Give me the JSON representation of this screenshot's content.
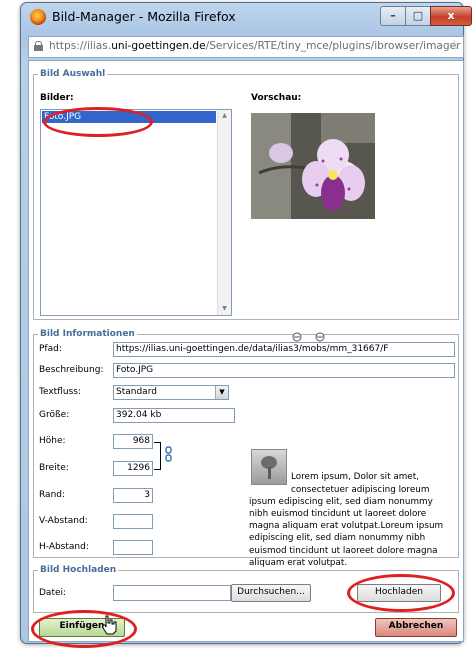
{
  "window": {
    "title": "Bild-Manager - Mozilla Firefox",
    "url_prefix": "https://ilias.",
    "url_domain": "uni-goettingen.de",
    "url_path": "/Services/RTE/tiny_mce/plugins/ibrowser/imager",
    "controls": {
      "minimize": "–",
      "maximize": "□",
      "close": "x"
    }
  },
  "bild_auswahl": {
    "legend": "Bild Auswahl",
    "bilder_label": "Bilder:",
    "vorschau_label": "Vorschau:",
    "images": [
      "Foto.JPG"
    ],
    "selected": "Foto.JPG"
  },
  "bild_informationen": {
    "legend": "Bild Informationen",
    "pfad": {
      "label": "Pfad:",
      "value": "https://ilias.uni-goettingen.de/data/ilias3/mobs/mm_31667/F"
    },
    "beschreibung": {
      "label": "Beschreibung:",
      "value": "Foto.JPG"
    },
    "textfluss": {
      "label": "Textfluss:",
      "value": "Standard"
    },
    "groesse": {
      "label": "Größe:",
      "value": "392.04 kb"
    },
    "hoehe": {
      "label": "Höhe:",
      "value": "968"
    },
    "breite": {
      "label": "Breite:",
      "value": "1296"
    },
    "rand": {
      "label": "Rand:",
      "value": "3"
    },
    "v_abstand": {
      "label": "V-Abstand:",
      "value": ""
    },
    "h_abstand": {
      "label": "H-Abstand:",
      "value": ""
    },
    "sample_text": "Lorem ipsum, Dolor sit amet, consectetuer adipiscing loreum ipsum edipiscing elit, sed diam nonummy nibh euismod tincidunt ut laoreet dolore magna aliquam erat volutpat.Loreum ipsum edipiscing elit, sed diam nonummy nibh euismod tincidunt ut laoreet dolore magna aliquam erat volutpat."
  },
  "bild_hochladen": {
    "legend": "Bild Hochladen",
    "datei_label": "Datei:",
    "browse_label": "Durchsuchen...",
    "upload_label": "Hochladen"
  },
  "actions": {
    "insert": "Einfügen",
    "cancel": "Abbrechen"
  },
  "colors": {
    "legend": "#4a6c9a",
    "selection": "#3266cc",
    "annotation": "#e02020"
  }
}
